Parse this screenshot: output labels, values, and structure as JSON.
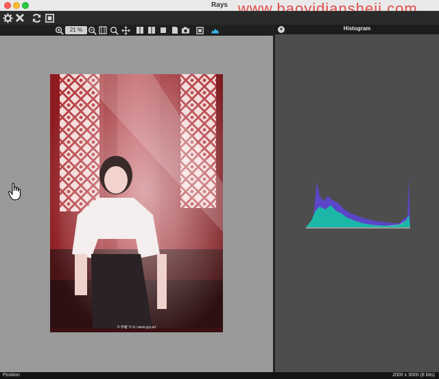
{
  "window": {
    "title": "Rays",
    "watermark": "www.baoyidiansheji.com"
  },
  "toolbar": {
    "zoom_value": "21 %"
  },
  "photo": {
    "caption": "© 作者 Yi Ji | www.yjzj.art"
  },
  "histogram": {
    "title": "Histogram",
    "close_label": "×"
  },
  "statusbar": {
    "left": "Position",
    "right": "2000 x 3000 (8 bits)"
  },
  "colors": {
    "accent_teal": "#1bb8a8",
    "accent_purple": "#5b45c8",
    "histogram_gray": "#bdbdbd"
  }
}
